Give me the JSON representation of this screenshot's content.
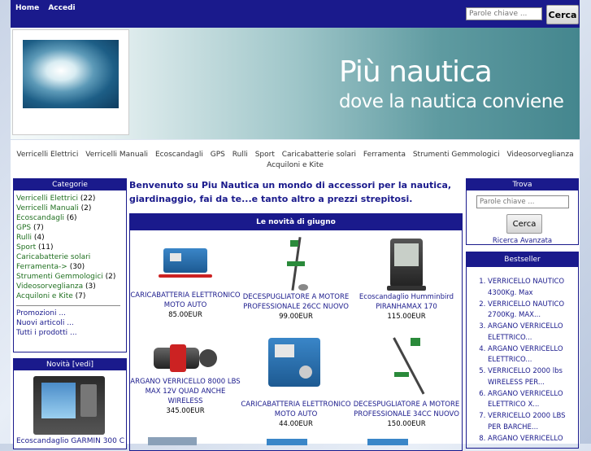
{
  "topbar": {
    "home_label": "Home",
    "login_label": "Accedi",
    "search_placeholder": "Parole chiave ...",
    "search_button": "Cerca"
  },
  "banner": {
    "title": "Più nautica",
    "subtitle": "dove la nautica conviene"
  },
  "category_nav": {
    "row1": [
      "Verricelli Elettrici",
      "Verricelli Manuali",
      "Ecoscandagli",
      "GPS",
      "Rulli",
      "Sport",
      "Caricabatterie solari",
      "Ferramenta",
      "Strumenti Gemmologici",
      "Videosorveglianza"
    ],
    "row2": [
      "Acquiloni e Kite"
    ]
  },
  "categories_box": {
    "title": "Categorie",
    "items": [
      {
        "label": "Verricelli Elettrici",
        "count": " (22)"
      },
      {
        "label": "Verricelli Manuali",
        "count": " (2)"
      },
      {
        "label": "Ecoscandagli",
        "count": " (6)"
      },
      {
        "label": "GPS",
        "count": " (7)"
      },
      {
        "label": "Rulli",
        "count": " (4)"
      },
      {
        "label": "Sport",
        "count": " (11)"
      },
      {
        "label": "Caricabatterie solari",
        "count": ""
      },
      {
        "label": "Ferramenta->",
        "count": " (30)"
      },
      {
        "label": "Strumenti Gemmologici",
        "count": " (2)"
      },
      {
        "label": "Videosorveglianza",
        "count": " (3)"
      },
      {
        "label": "Acquiloni e Kite",
        "count": " (7)"
      }
    ],
    "extras": [
      "Promozioni ...",
      "Nuovi articoli ...",
      "Tutti i prodotti ..."
    ]
  },
  "news_box": {
    "title": "Novità  [vedi]",
    "caption": "Ecoscandaglio GARMIN 300 C"
  },
  "main": {
    "welcome": "Benvenuto su Piu Nautica un mondo di accessori per la nautica, giardinaggio, fai da te...e tanto altro a prezzi strepitosi.",
    "news_title": "Le novità di giugno",
    "products": [
      {
        "name": "CARICABATTERIA ELETTRONICO MOTO AUTO",
        "price": "85.00EUR"
      },
      {
        "name": "DECESPUGLIATORE A MOTORE PROFESSIONALE 26CC NUOVO",
        "price": "99.00EUR"
      },
      {
        "name": "Ecoscandaglio Humminbird PIRANHAMAX 170",
        "price": "115.00EUR"
      },
      {
        "name": "ARGANO VERRICELLO 8000 LBS MAX 12V QUAD ANCHE WIRELESS",
        "price": "345.00EUR"
      },
      {
        "name": "CARICABATTERIA ELETTRONICO MOTO AUTO",
        "price": "44.00EUR"
      },
      {
        "name": "DECESPUGLIATORE A MOTORE PROFESSIONALE 34CC NUOVO",
        "price": "150.00EUR"
      }
    ]
  },
  "find_box": {
    "title": "Trova",
    "placeholder": "Parole chiave ...",
    "button": "Cerca",
    "advanced": "Ricerca Avanzata"
  },
  "bestseller_box": {
    "title": "Bestseller",
    "items": [
      "VERRICELLO NAUTICO 4300Kg. Max",
      "VERRICELLO NAUTICO 2700Kg. MAX...",
      "ARGANO VERRICELLO ELETTRICO...",
      "ARGANO VERRICELLO ELETTRICO...",
      "VERRICELLO 2000 lbs WIRELESS PER...",
      "ARGANO VERRICELLO ELETTRICO X...",
      "VERRICELLO 2000 LBS PER BARCHE...",
      "ARGANO VERRICELLO"
    ]
  },
  "colors": {
    "primary": "#1a1a8c",
    "category_link": "#207020"
  }
}
